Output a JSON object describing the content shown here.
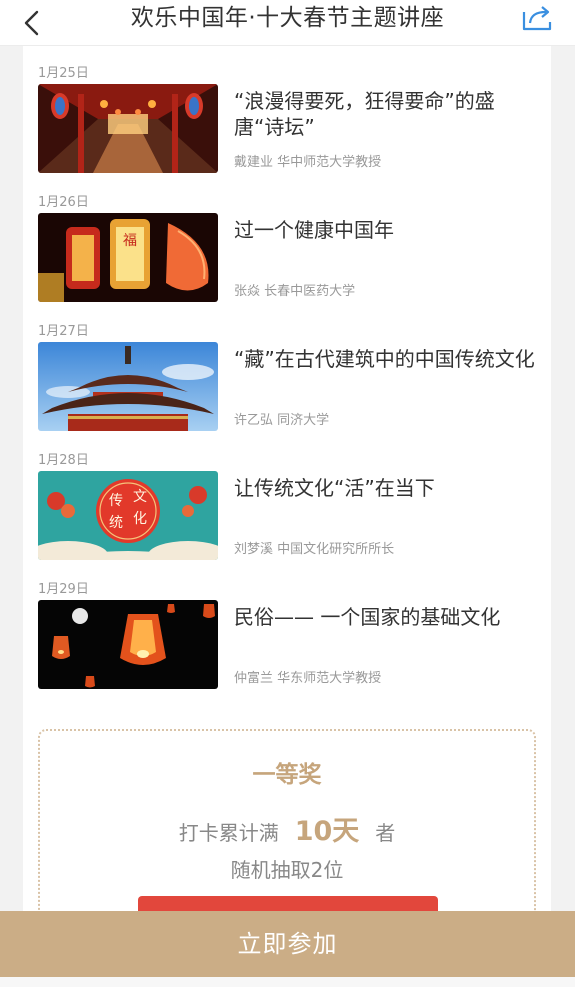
{
  "header": {
    "title": "欢乐中国年·十大春节主题讲座",
    "back_icon": "chevron-left-icon",
    "share_icon": "share-icon"
  },
  "lectures": [
    {
      "date": "1月25日",
      "title": "“浪漫得要死，狂得要命”的盛唐“诗坛”",
      "byline": "戴建业 华中师范大学教授",
      "thumb": "lantern-corridor"
    },
    {
      "date": "1月26日",
      "title": "过一个健康中国年",
      "byline": "张焱 长春中医药大学",
      "thumb": "red-lanterns"
    },
    {
      "date": "1月27日",
      "title": "“藏”在古代建筑中的中国传统文化",
      "byline": "许乙弘 同济大学",
      "thumb": "pagoda-roof"
    },
    {
      "date": "1月28日",
      "title": "让传统文化“活”在当下",
      "byline": "刘梦溪 中国文化研究所所长",
      "thumb": "culture-seal",
      "thumb_text": [
        "传",
        "文",
        "统",
        "化"
      ]
    },
    {
      "date": "1月29日",
      "title": "民俗—— 一个国家的基础文化",
      "byline": "仲富兰 华东师范大学教授",
      "thumb": "sky-lanterns"
    }
  ],
  "prize": {
    "title": "一等奖",
    "cond_prefix": "打卡累计满",
    "days": "10天",
    "cond_suffix": "者",
    "draw": "随机抽取2位"
  },
  "cta": {
    "label": "立即参加"
  },
  "colors": {
    "accent": "#cbad86",
    "gold_text": "#c6a57c",
    "red": "#e2473c"
  }
}
